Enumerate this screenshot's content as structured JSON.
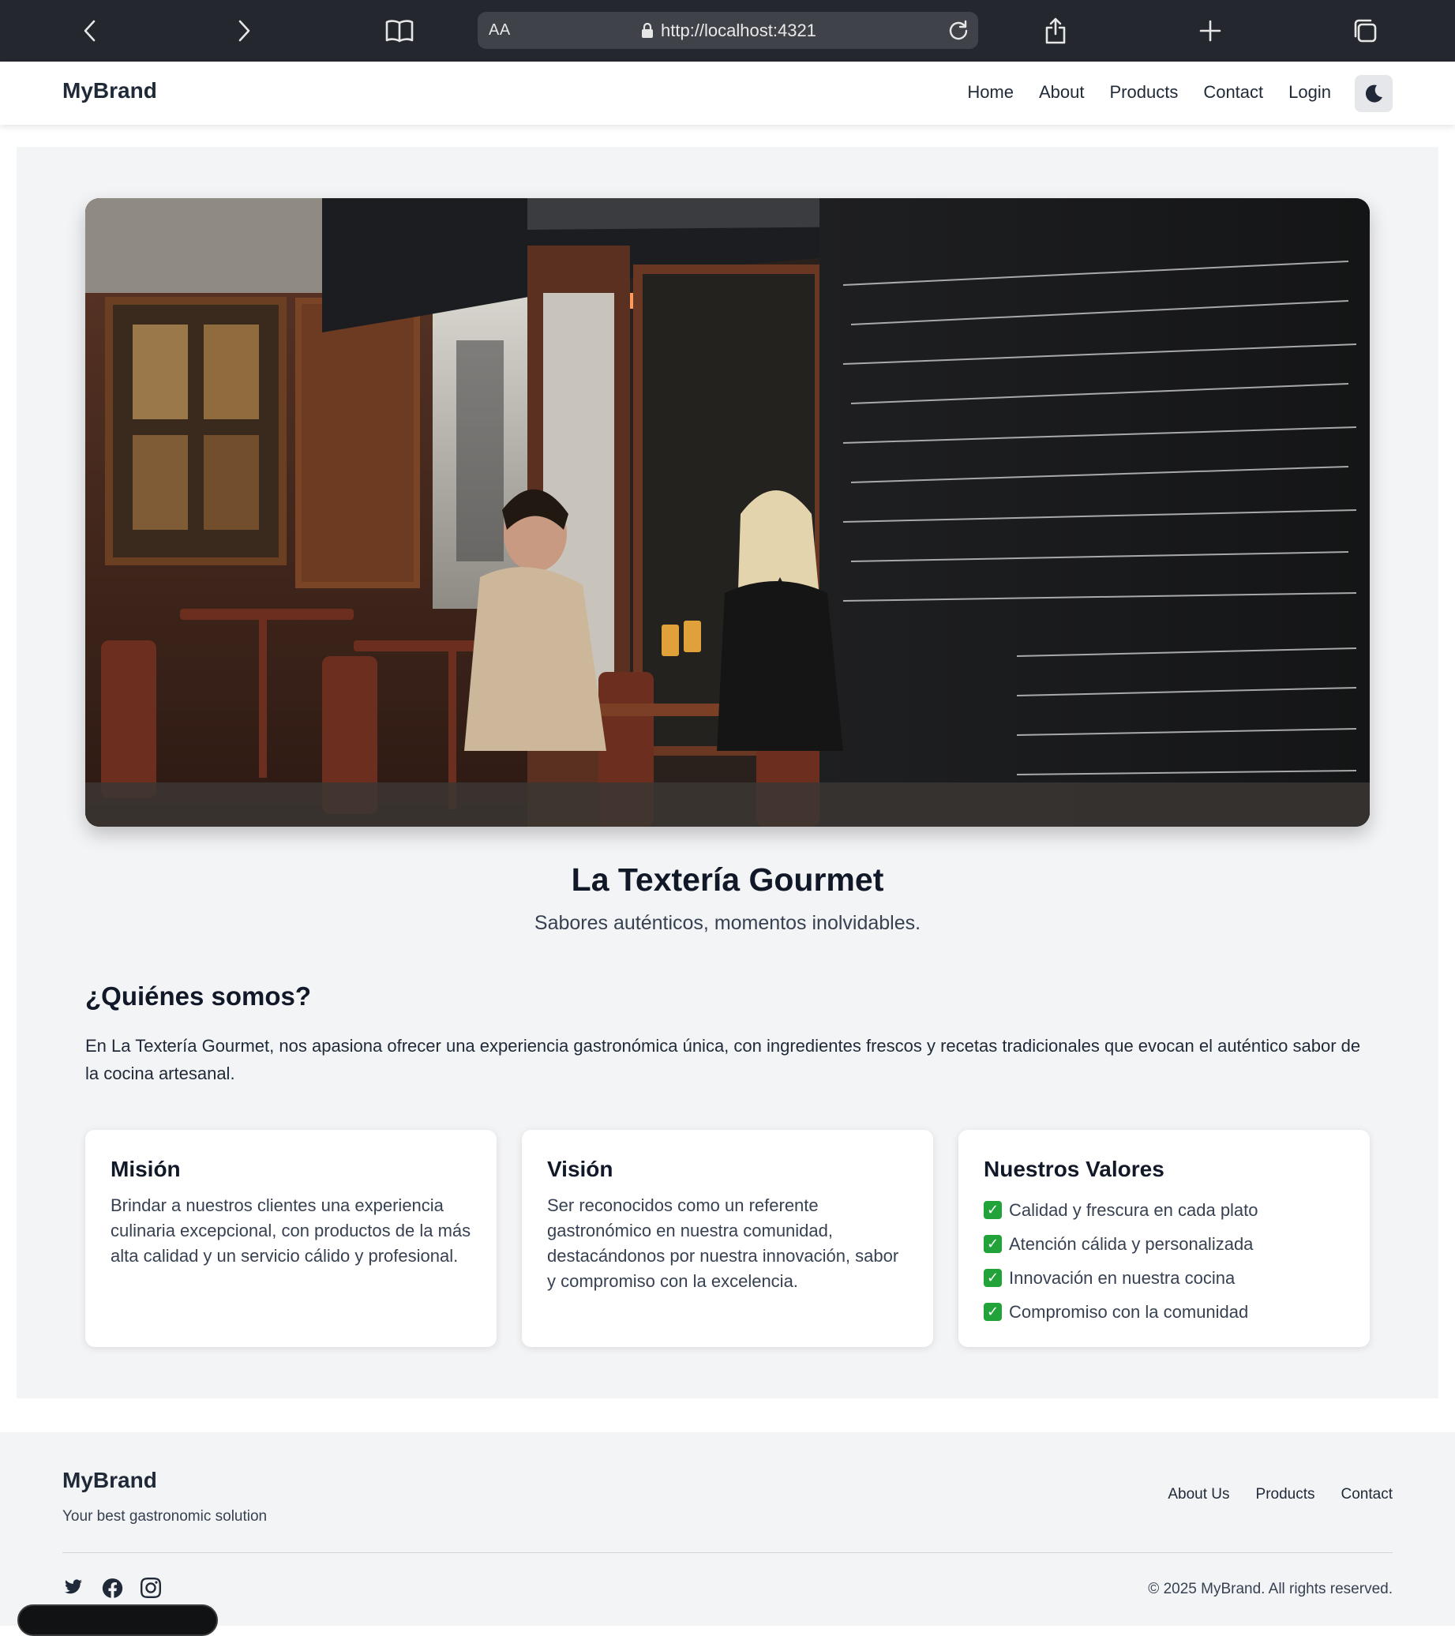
{
  "browser": {
    "url": "http://localhost:4321",
    "reader_label": "AA"
  },
  "nav": {
    "brand": "MyBrand",
    "links": [
      "Home",
      "About",
      "Products",
      "Contact",
      "Login"
    ]
  },
  "hero": {
    "image": "photo-restaurant-couple-toasting-icon"
  },
  "title": "La Textería Gourmet",
  "subtitle": "Sabores auténticos, momentos inolvidables.",
  "about": {
    "heading": "¿Quiénes somos?",
    "text": "En La Textería Gourmet, nos apasiona ofrecer una experiencia gastronómica única, con ingredientes frescos y recetas tradicionales que evocan el auténtico sabor de la cocina artesanal."
  },
  "cards": {
    "mision": {
      "title": "Misión",
      "text": "Brindar a nuestros clientes una experiencia culinaria excepcional, con productos de la más alta calidad y un servicio cálido y profesional."
    },
    "vision": {
      "title": "Visión",
      "text": "Ser reconocidos como un referente gastronómico en nuestra comunidad, destacándonos por nuestra innovación, sabor y compromiso con la excelencia."
    },
    "valores": {
      "title": "Nuestros Valores",
      "items": [
        "Calidad y frescura en cada plato",
        "Atención cálida y personalizada",
        "Innovación en nuestra cocina",
        "Compromiso con la comunidad"
      ]
    }
  },
  "footer": {
    "brand": "MyBrand",
    "tagline": "Your best gastronomic solution",
    "links": [
      "About Us",
      "Products",
      "Contact"
    ],
    "copyright": "© 2025 MyBrand. All rights reserved.",
    "social": [
      "twitter-icon",
      "facebook-icon",
      "instagram-icon"
    ]
  },
  "colors": {
    "browser_bar": "#24282e",
    "page_bg": "#f3f4f6",
    "check_green": "#22a33a"
  }
}
